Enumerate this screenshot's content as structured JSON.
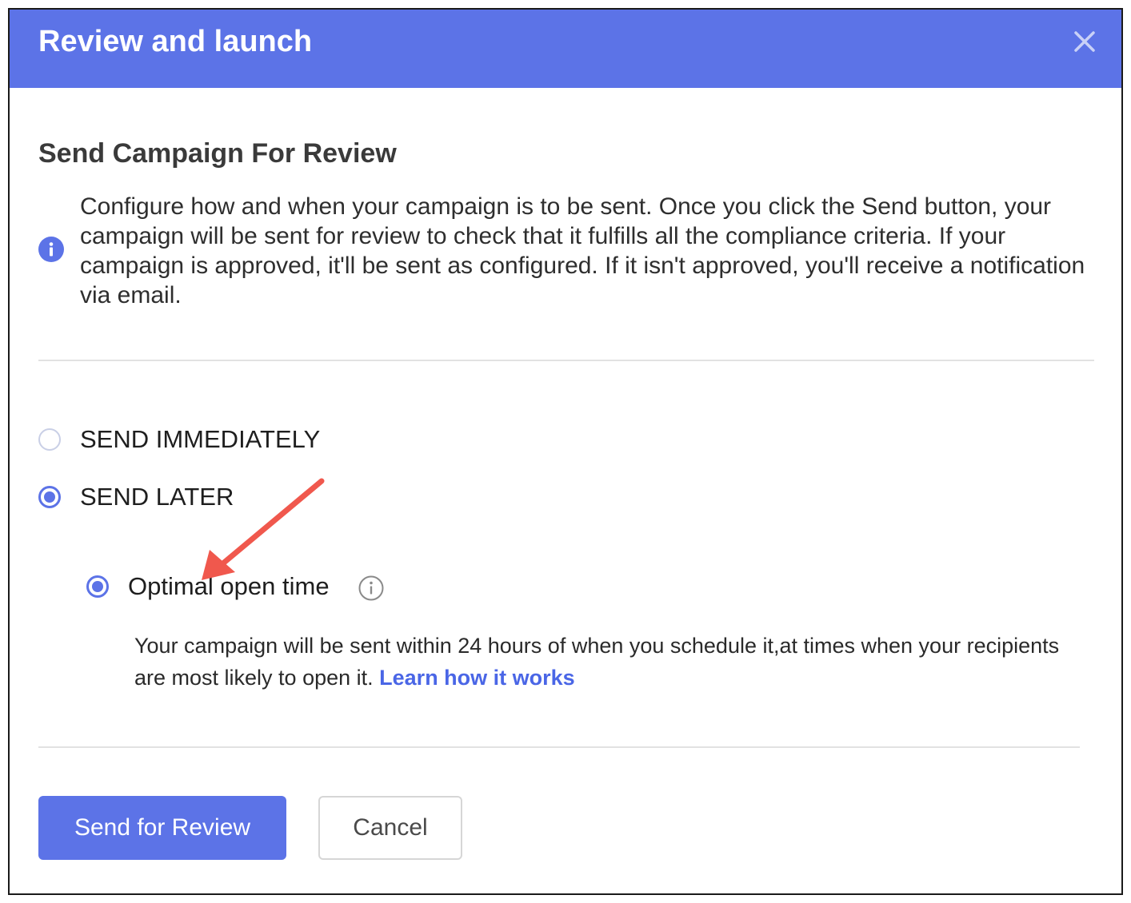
{
  "dialog": {
    "title": "Review and launch",
    "close_icon": "close-icon"
  },
  "section": {
    "title": "Send Campaign For Review",
    "info_icon": "info-icon",
    "info_text": "Configure how and when your campaign is to be sent. Once you click the Send button, your campaign will be sent for review to check that it fulfills all the compliance criteria. If your campaign is approved, it'll be sent as configured. If it isn't approved, you'll receive a notification via email."
  },
  "send_options": [
    {
      "label": "SEND IMMEDIATELY",
      "selected": false
    },
    {
      "label": "SEND LATER",
      "selected": true
    }
  ],
  "send_later": {
    "option_label": "Optimal open time",
    "option_selected": true,
    "tooltip_icon": "info-outline-icon",
    "description": "Your campaign will be sent within 24 hours of when you schedule it,at times when your recipients are most likely to open it.",
    "link_text": "Learn how it works"
  },
  "buttons": {
    "primary": "Send for Review",
    "secondary": "Cancel"
  },
  "colors": {
    "accent": "#5c73e7",
    "link": "#4a66e6",
    "annotation_arrow": "#f0584d"
  }
}
